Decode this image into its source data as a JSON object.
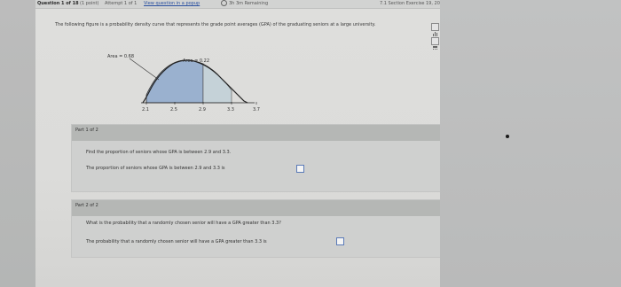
{
  "topbar": {
    "question": "Question 1 of 18",
    "points": "(1 point)",
    "attempt": "Attempt 1 of 1",
    "view_link": "View question in a popup",
    "remaining": "3h 3m Remaining",
    "homework": "7.1 Section Exercise",
    "score": "19, 20"
  },
  "prompt": "The following figure is a probability density curve that represents the grade point averages (GPA) of the graduating seniors at a large university.",
  "chart_data": {
    "type": "area",
    "x_ticks": [
      "2.1",
      "2.5",
      "2.9",
      "3.3",
      "3.7"
    ],
    "annotations": [
      {
        "label": "Area = 0.68",
        "from": 2.1,
        "to": 2.9
      },
      {
        "label": "Area = 0.22",
        "from": 2.9,
        "to": 3.3
      }
    ],
    "colors": {
      "left_area": "#9ab1cf",
      "right_area": "#c5d2d8",
      "curve": "#222222"
    }
  },
  "part1": {
    "header": "Part 1 of 2",
    "question": "Find the proportion of seniors whose GPA is between 2.9 and 3.3.",
    "answer_lead": "The proportion of seniors whose GPA is between 2.9 and 3.3 is"
  },
  "part2": {
    "header": "Part 2 of 2",
    "question": "What is the probability that a randomly chosen senior will have a GPA greater than 3.3?",
    "answer_lead": "The probability that a randomly chosen senior will have a GPA greater than 3.3 is"
  },
  "icons": {
    "side_top": "data-icon",
    "side_bottom": "calculator-icon"
  }
}
